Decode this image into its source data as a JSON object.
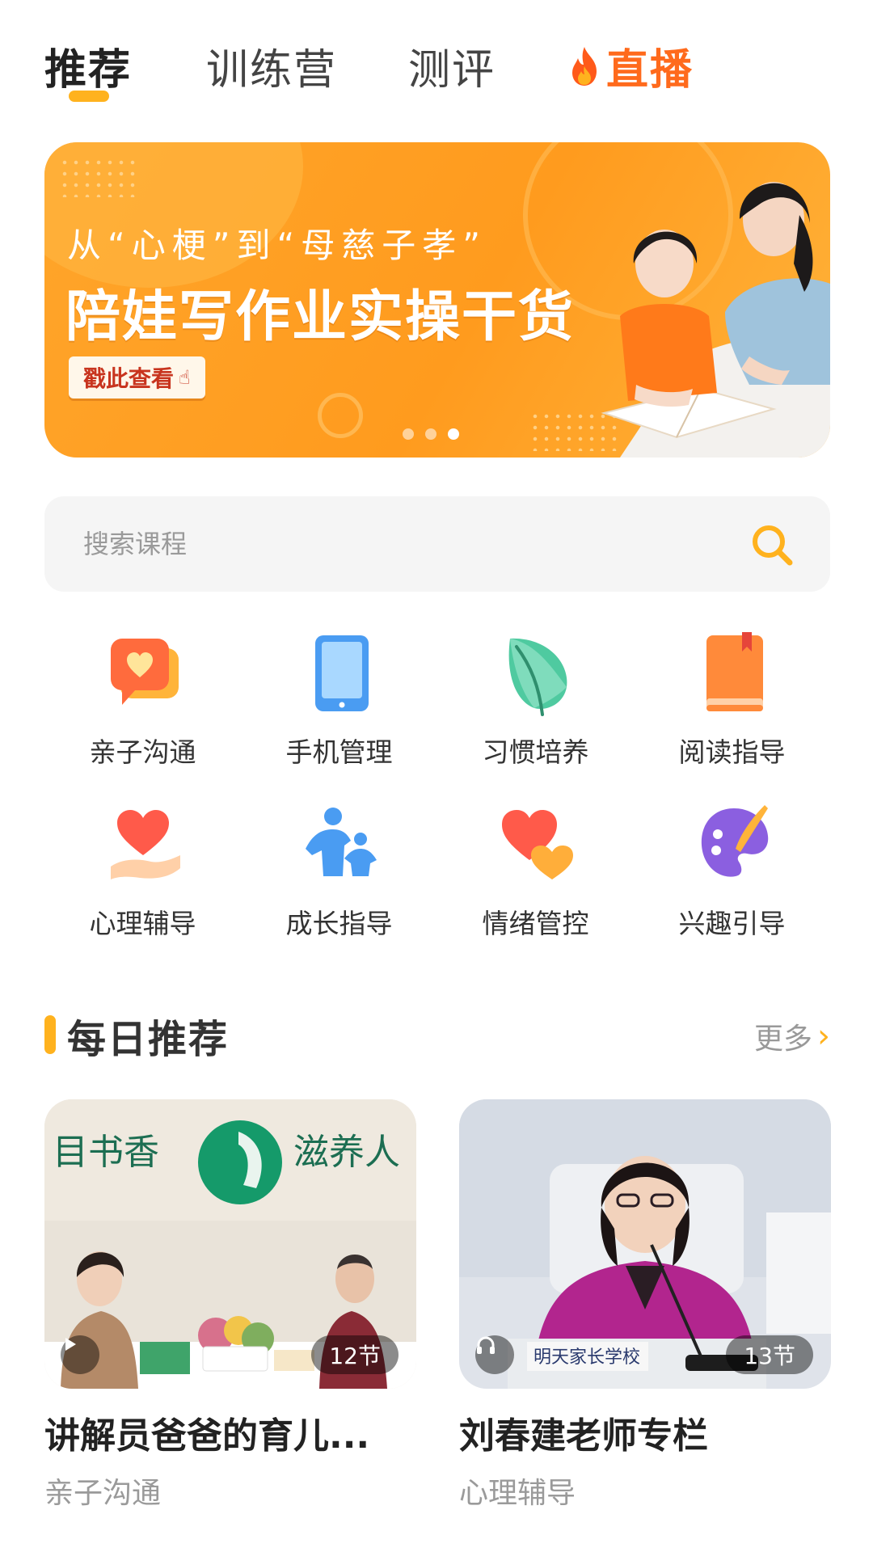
{
  "tabs": [
    {
      "label": "推荐",
      "active": true
    },
    {
      "label": "训练营",
      "active": false
    },
    {
      "label": "测评",
      "active": false
    },
    {
      "label": "直播",
      "active": false,
      "icon": "fire-icon"
    }
  ],
  "banner": {
    "subtitle": "从“心梗”到“母慈子孝”",
    "headline": "陪娃写作业实操干货",
    "cta": "戳此查看",
    "pages": 3,
    "active_page": 3
  },
  "search": {
    "placeholder": "搜索课程"
  },
  "categories": [
    {
      "label": "亲子沟通",
      "icon": "chat-heart-icon"
    },
    {
      "label": "手机管理",
      "icon": "tablet-icon"
    },
    {
      "label": "习惯培养",
      "icon": "leaf-icon"
    },
    {
      "label": "阅读指导",
      "icon": "book-icon"
    },
    {
      "label": "心理辅导",
      "icon": "heart-hand-icon"
    },
    {
      "label": "成长指导",
      "icon": "parent-child-icon"
    },
    {
      "label": "情绪管控",
      "icon": "two-hearts-icon"
    },
    {
      "label": "兴趣引导",
      "icon": "palette-icon"
    }
  ],
  "daily": {
    "title": "每日推荐",
    "more": "更多"
  },
  "courses": [
    {
      "title": "讲解员爸爸的育儿...",
      "category": "亲子沟通",
      "lessons": "12节",
      "media": "video"
    },
    {
      "title": "刘春建老师专栏",
      "category": "心理辅导",
      "lessons": "13节",
      "media": "audio"
    }
  ],
  "colors": {
    "accent": "#ffb21e",
    "live": "#ff6a1c",
    "banner": "#ff9b1e"
  }
}
